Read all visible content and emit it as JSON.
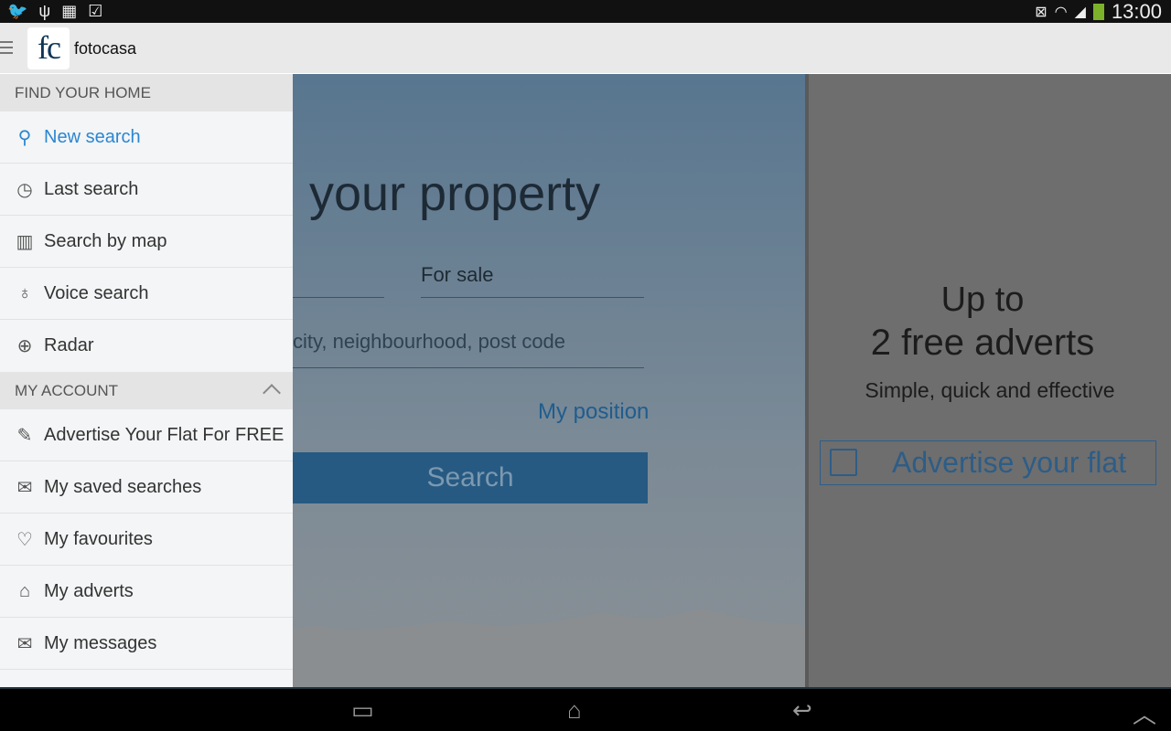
{
  "status_bar": {
    "time": "13:00",
    "left_icons": [
      "twitter-icon",
      "usb-icon",
      "sim-icon",
      "clipboard-check-icon"
    ],
    "right_icons": [
      "mute-icon",
      "wifi-icon",
      "signal-icon",
      "battery-icon"
    ]
  },
  "app_bar": {
    "logo": "fc",
    "app_name": "fotocasa"
  },
  "drawer": {
    "section1": "FIND YOUR HOME",
    "items1": [
      {
        "label": "New search",
        "icon": "search-icon"
      },
      {
        "label": "Last search",
        "icon": "history-icon"
      },
      {
        "label": "Search by map",
        "icon": "map-icon"
      },
      {
        "label": "Voice search",
        "icon": "microphone-icon"
      },
      {
        "label": "Radar",
        "icon": "radar-icon"
      }
    ],
    "section2": "MY ACCOUNT",
    "items2": [
      {
        "label": "Advertise Your Flat For FREE",
        "icon": "edit-icon"
      },
      {
        "label": "My saved searches",
        "icon": "inbox-icon"
      },
      {
        "label": "My favourites",
        "icon": "heart-icon"
      },
      {
        "label": "My adverts",
        "icon": "home-icon"
      },
      {
        "label": "My messages",
        "icon": "mail-icon"
      }
    ]
  },
  "main": {
    "title": "your property",
    "operation": "For sale",
    "location_placeholder": "city, neighbourhood, post code",
    "my_position": "My position",
    "search_button": "Search"
  },
  "promo": {
    "line1": "Up to",
    "line2": "2 free adverts",
    "line3": "Simple, quick and effective",
    "button": "Advertise your flat"
  },
  "colors": {
    "accent": "#2b86d1",
    "brand": "#0e3556"
  }
}
